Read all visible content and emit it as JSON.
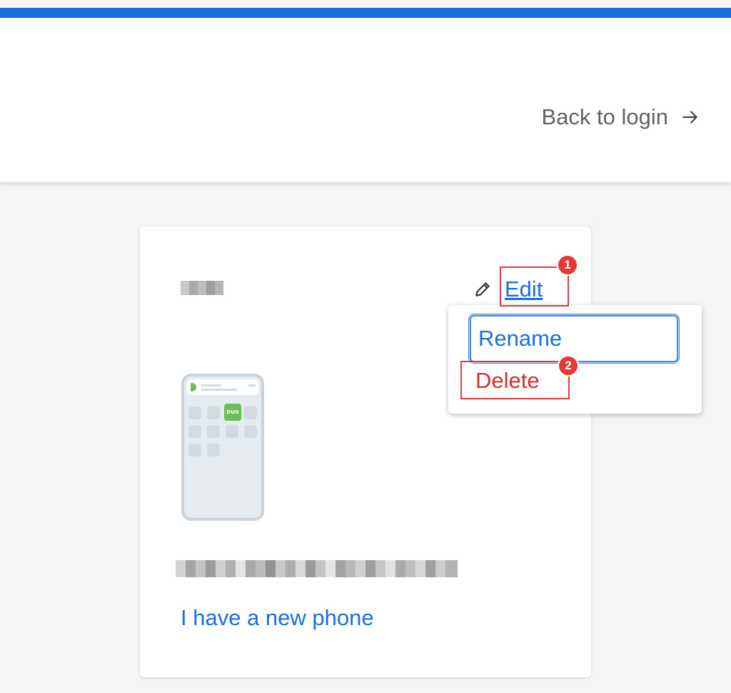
{
  "header": {
    "back_to_login": "Back to login",
    "arrow_icon": "arrow-right-icon",
    "accent_color": "#1a6fe0"
  },
  "device_card": {
    "device_label_redacted": true,
    "edit_label": "Edit",
    "pencil_icon": "pencil-icon",
    "device_model_redacted": true,
    "new_phone_link": "I have a new phone"
  },
  "edit_menu": {
    "items": [
      {
        "label": "Rename",
        "color": "#1a6fe0"
      },
      {
        "label": "Delete",
        "color": "#d32f2f"
      }
    ]
  },
  "annotations": {
    "badges": [
      "1",
      "2"
    ],
    "color": "#e53935"
  }
}
